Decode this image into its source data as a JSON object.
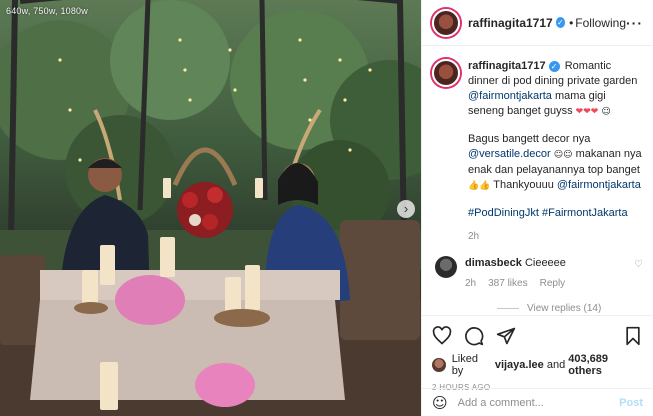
{
  "photo": {
    "watermark": "640w, 750w, 1080w",
    "next_icon": "chevron-right-icon"
  },
  "post": {
    "username": "raffinagita1717",
    "follow_label": "Following",
    "separator": "•",
    "more_icon": "more-options-icon"
  },
  "caption": {
    "username": "raffinagita1717",
    "line1": "Romantic dinner di pod dining private garden",
    "mention1": "@fairmontjakarta",
    "line2": "mama gigi seneng banget guyss",
    "line2_emoji": "❤❤❤",
    "line2_emoji2": "☺",
    "line3": "Bagus bangett decor nya",
    "mention2": "@versatile.decor",
    "line3_emoji": "☺☺",
    "line4": "makanan nya enak dan pelayanannya top banget",
    "line4_emoji": "👍👍",
    "line4_end": "Thankyouuu",
    "mention3": "@fairmontjakarta",
    "hashtag1": "#PodDiningJkt",
    "hashtag2": "#FairmontJakarta",
    "age": "2h"
  },
  "comments": [
    {
      "username": "dimasbeck",
      "text": "Cieeeee",
      "age": "2h",
      "likes": "387 likes",
      "reply": "Reply",
      "view_replies": "View replies (14)"
    }
  ],
  "actions": {
    "liked_by_prefix": "Liked by",
    "liked_by_user": "vijaya.lee",
    "liked_by_and": "and",
    "liked_by_others": "403,689 others",
    "timestamp": "2 HOURS AGO"
  },
  "add_comment": {
    "placeholder": "Add a comment...",
    "post_label": "Post"
  },
  "colors": {
    "accent_blue": "#3897f0",
    "link_blue": "#00376b",
    "muted": "#8e8e8e",
    "heart_red": "#ed4956"
  }
}
